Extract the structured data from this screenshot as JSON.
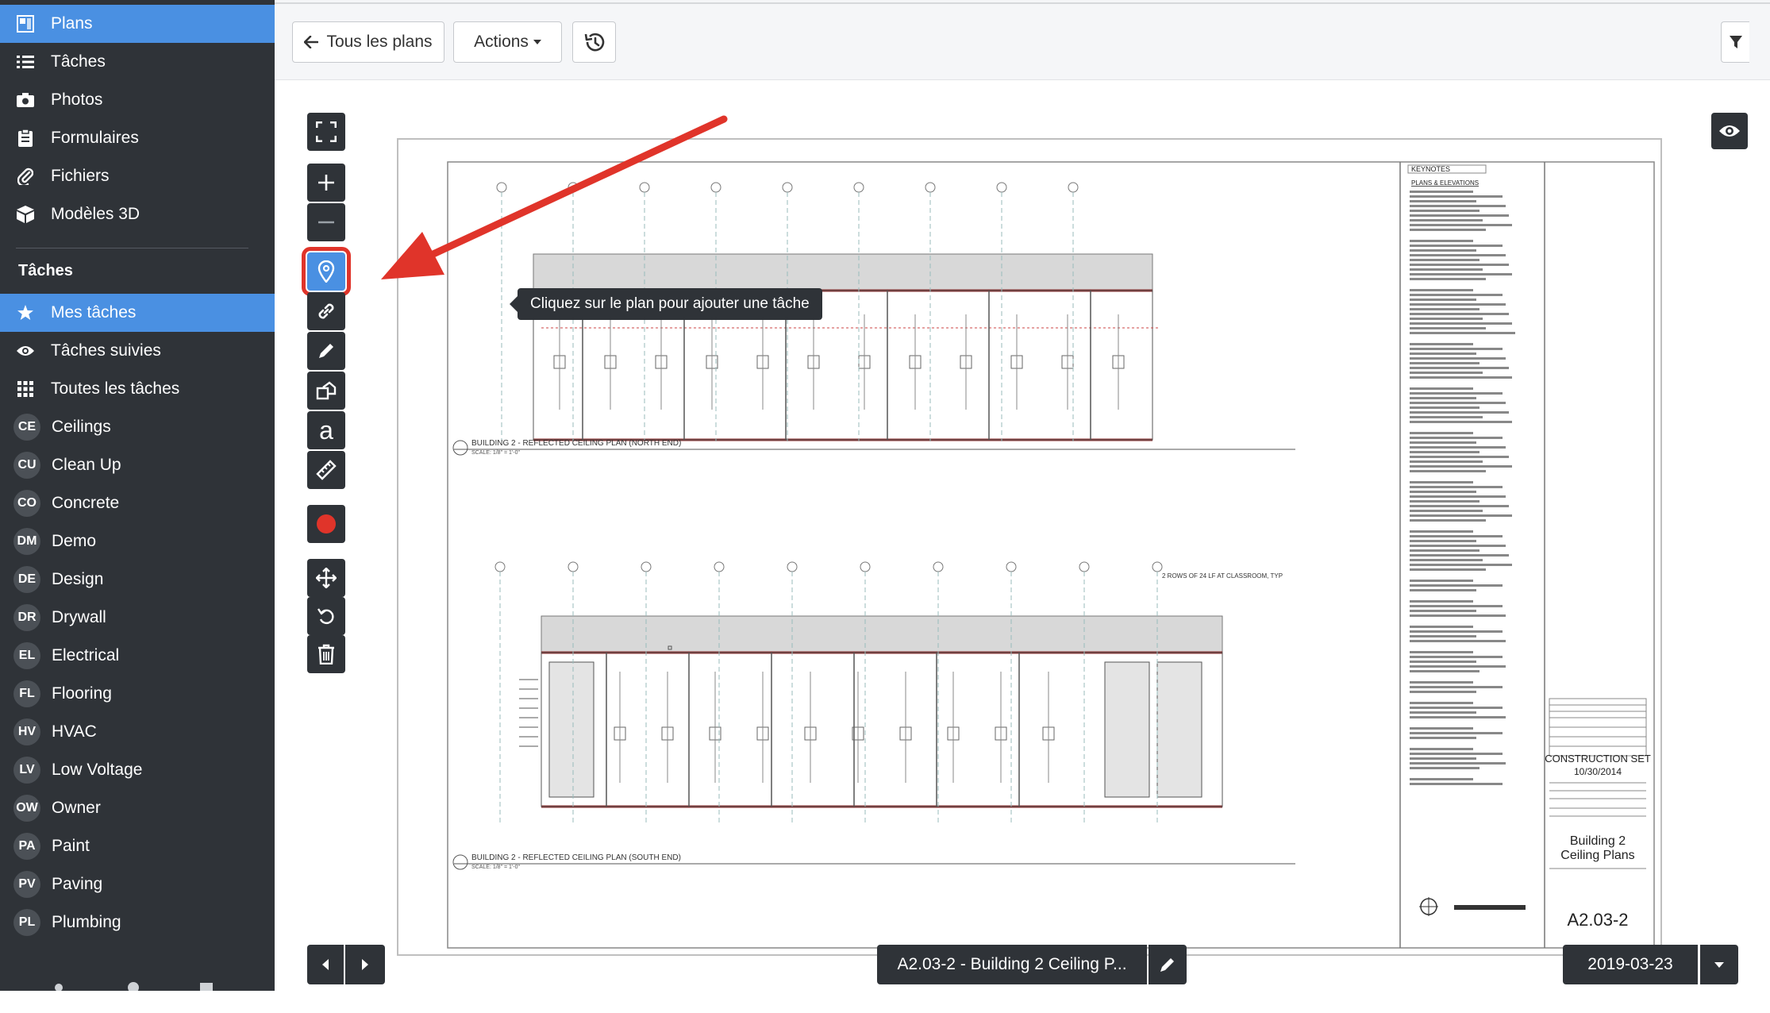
{
  "sidebar": {
    "nav": [
      {
        "label": "Plans",
        "icon": "plans-icon"
      },
      {
        "label": "Tâches",
        "icon": "list-icon"
      },
      {
        "label": "Photos",
        "icon": "camera-icon"
      },
      {
        "label": "Formulaires",
        "icon": "clipboard-icon"
      },
      {
        "label": "Fichiers",
        "icon": "paperclip-icon"
      },
      {
        "label": "Modèles 3D",
        "icon": "cube-icon"
      }
    ],
    "section_title": "Tâches",
    "task_views": [
      {
        "label": "Mes tâches",
        "icon": "star-icon"
      },
      {
        "label": "Tâches suivies",
        "icon": "eye-icon"
      },
      {
        "label": "Toutes les tâches",
        "icon": "grid-icon"
      }
    ],
    "categories": [
      {
        "abbr": "CE",
        "label": "Ceilings"
      },
      {
        "abbr": "CU",
        "label": "Clean Up"
      },
      {
        "abbr": "CO",
        "label": "Concrete"
      },
      {
        "abbr": "DM",
        "label": "Demo"
      },
      {
        "abbr": "DE",
        "label": "Design"
      },
      {
        "abbr": "DR",
        "label": "Drywall"
      },
      {
        "abbr": "EL",
        "label": "Electrical"
      },
      {
        "abbr": "FL",
        "label": "Flooring"
      },
      {
        "abbr": "HV",
        "label": "HVAC"
      },
      {
        "abbr": "LV",
        "label": "Low Voltage"
      },
      {
        "abbr": "OW",
        "label": "Owner"
      },
      {
        "abbr": "PA",
        "label": "Paint"
      },
      {
        "abbr": "PV",
        "label": "Paving"
      },
      {
        "abbr": "PL",
        "label": "Plumbing"
      }
    ]
  },
  "toolbar": {
    "back_label": "Tous les plans",
    "actions_label": "Actions",
    "history_icon": "history-icon"
  },
  "tooltip": "Cliquez sur le plan pour ajouter une tâche",
  "footer": {
    "sheet_name": "A2.03-2 - Building 2 Ceiling P...",
    "version_date": "2019-03-23"
  },
  "plan": {
    "keynotes_title": "KEYNOTES",
    "plans_elevations": "PLANS & ELEVATIONS",
    "caption_north": "BUILDING 2 - REFLECTED CEILING PLAN (NORTH END)",
    "caption_south": "BUILDING 2 - REFLECTED CEILING PLAN (SOUTH END)",
    "scale": "SCALE: 1/8\" = 1'-0\"",
    "set_title": "CONSTRUCTION SET",
    "set_date": "10/30/2014",
    "sheet_title_1": "Building 2",
    "sheet_title_2": "Ceiling Plans",
    "sheet_no": "A2.03-2",
    "note_rows": "2 ROWS OF 24 LF AT CLASSROOM, TYP"
  },
  "colors": {
    "sidebar_bg": "#2f3338",
    "accent": "#4a90e2",
    "highlight_red": "#e0342a"
  }
}
